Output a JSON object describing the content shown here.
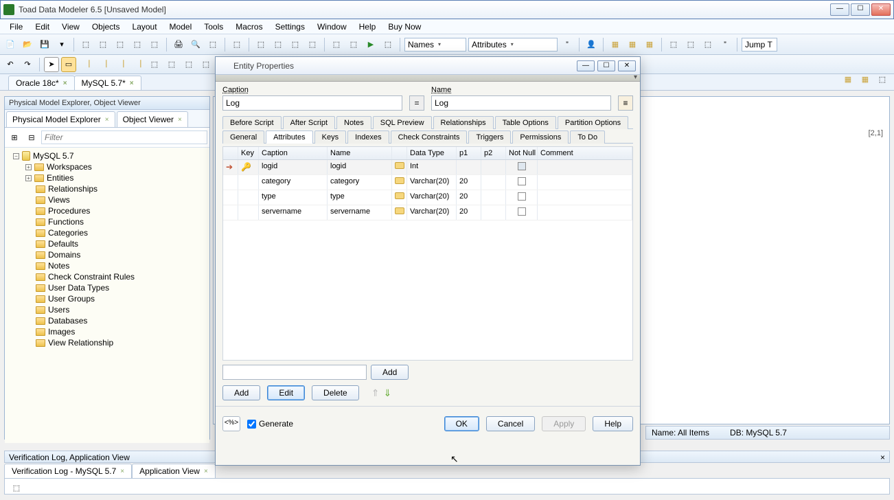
{
  "window": {
    "title": "Toad Data Modeler 6.5 [Unsaved Model]",
    "min": "—",
    "max": "☐",
    "close": "✕"
  },
  "menu": [
    "File",
    "Edit",
    "View",
    "Objects",
    "Layout",
    "Model",
    "Tools",
    "Macros",
    "Settings",
    "Window",
    "Help",
    "Buy Now"
  ],
  "toolbarCombo1": "Names",
  "toolbarCombo2": "Attributes",
  "toolbarJump": "Jump T",
  "docTabs": [
    {
      "label": "Oracle 18c*",
      "active": false
    },
    {
      "label": "MySQL 5.7*",
      "active": true
    }
  ],
  "leftPanel": {
    "header": "Physical Model Explorer, Object Viewer",
    "tabs": [
      {
        "label": "Physical Model Explorer"
      },
      {
        "label": "Object Viewer"
      }
    ],
    "filterPlaceholder": "Filter",
    "tree": {
      "root": "MySQL 5.7",
      "items": [
        "Workspaces",
        "Entities",
        "Relationships",
        "Views",
        "Procedures",
        "Functions",
        "Categories",
        "Defaults",
        "Domains",
        "Notes",
        "Check Constraint Rules",
        "User Data Types",
        "User Groups",
        "Users",
        "Databases",
        "Images",
        "View Relationship"
      ]
    }
  },
  "coord": "[2,1]",
  "dialog": {
    "title": "Entity Properties",
    "captionLabel": "Caption",
    "nameLabel": "Name",
    "captionValue": "Log",
    "nameValue": "Log",
    "tabsTop": [
      "Before Script",
      "After Script",
      "Notes",
      "SQL Preview",
      "Relationships",
      "Table Options",
      "Partition Options"
    ],
    "tabsBottom": [
      "General",
      "Attributes",
      "Keys",
      "Indexes",
      "Check Constraints",
      "Triggers",
      "Permissions",
      "To Do"
    ],
    "activeTab": "Attributes",
    "columns": [
      "",
      "Key",
      "Caption",
      "Name",
      "",
      "Data Type",
      "p1",
      "p2",
      "Not Null",
      "Comment"
    ],
    "rows": [
      {
        "sel": true,
        "key": true,
        "caption": "logid",
        "name": "logid",
        "dt": "Int",
        "p1": "",
        "p2": "",
        "nn": true
      },
      {
        "sel": false,
        "key": false,
        "caption": "category",
        "name": "category",
        "dt": "Varchar(20)",
        "p1": "20",
        "p2": "",
        "nn": false
      },
      {
        "sel": false,
        "key": false,
        "caption": "type",
        "name": "type",
        "dt": "Varchar(20)",
        "p1": "20",
        "p2": "",
        "nn": false
      },
      {
        "sel": false,
        "key": false,
        "caption": "servername",
        "name": "servername",
        "dt": "Varchar(20)",
        "p1": "20",
        "p2": "",
        "nn": false
      }
    ],
    "addLabel": "Add",
    "btnAdd": "Add",
    "btnEdit": "Edit",
    "btnDelete": "Delete",
    "generate": "Generate",
    "ok": "OK",
    "cancel": "Cancel",
    "apply": "Apply",
    "help": "Help"
  },
  "status": {
    "name": "Name: All Items",
    "db": "DB: MySQL 5.7"
  },
  "bottomPanel": {
    "header": "Verification Log, Application View",
    "tabs": [
      {
        "label": "Verification Log - MySQL 5.7"
      },
      {
        "label": "Application View"
      }
    ]
  }
}
